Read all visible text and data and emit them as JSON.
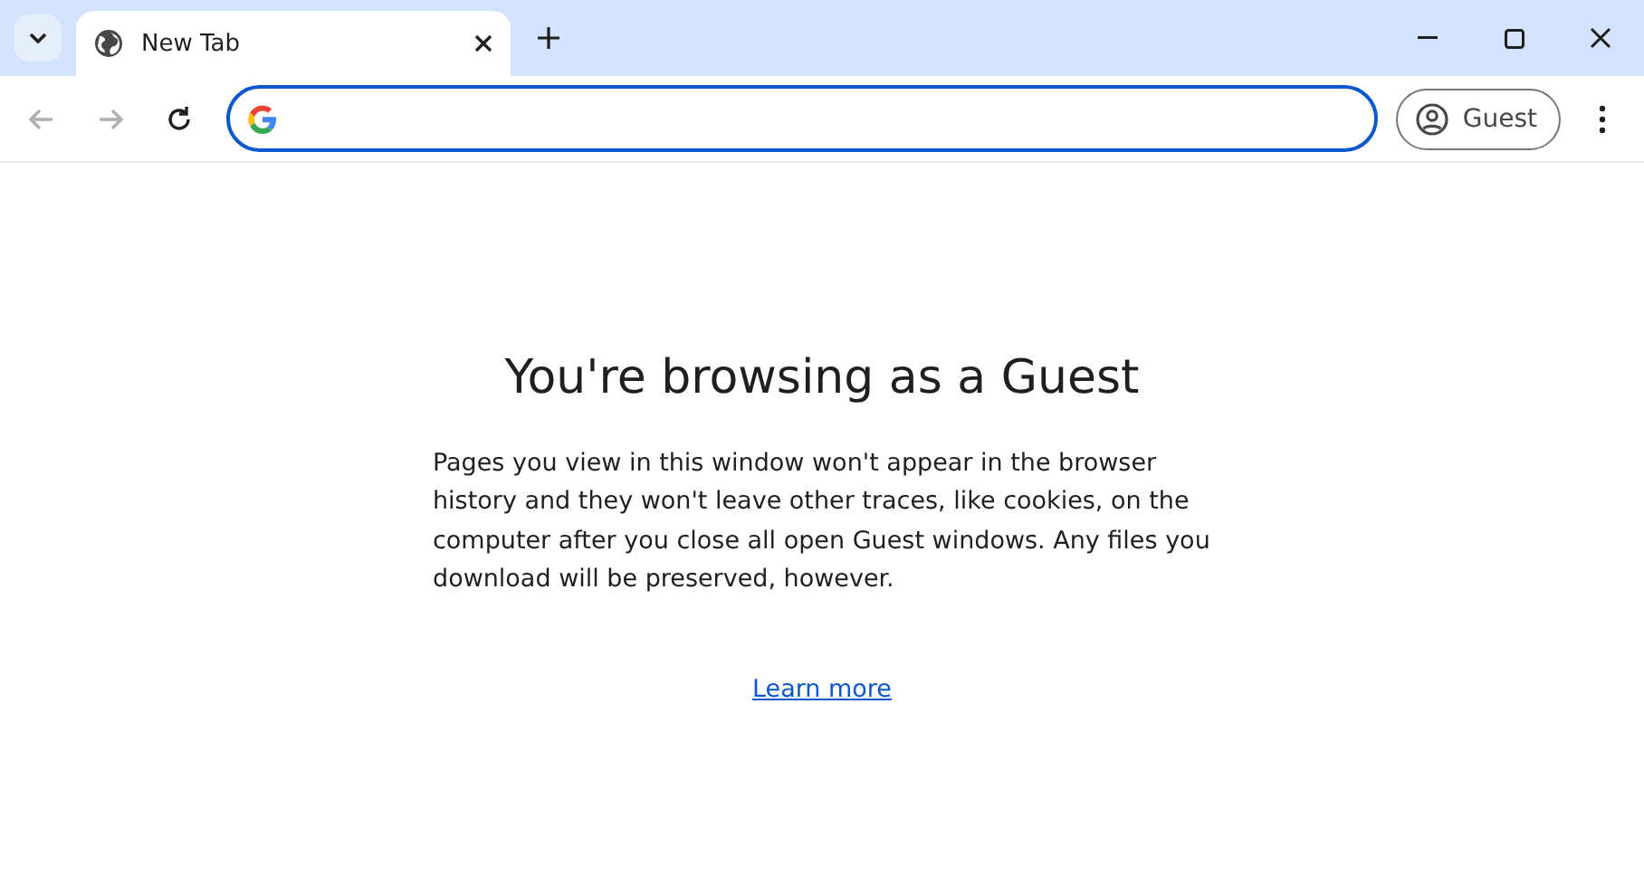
{
  "tab_strip": {
    "tabs": [
      {
        "title": "New Tab",
        "selected": true
      }
    ]
  },
  "toolbar": {
    "nav_buttons": [
      {
        "kind": "back",
        "disabled": true
      },
      {
        "kind": "forward",
        "disabled": true
      },
      {
        "kind": "reload",
        "disabled": false
      }
    ],
    "profile": {
      "label": "Guest"
    }
  },
  "page": {
    "heading": "You're browsing as a Guest",
    "body": "Pages you view in this window won't appear in the browser history and they won't leave other traces, like cookies, on the computer after you close all open Guest windows. Any files you download will be preserved, however.",
    "link": "Learn more"
  }
}
